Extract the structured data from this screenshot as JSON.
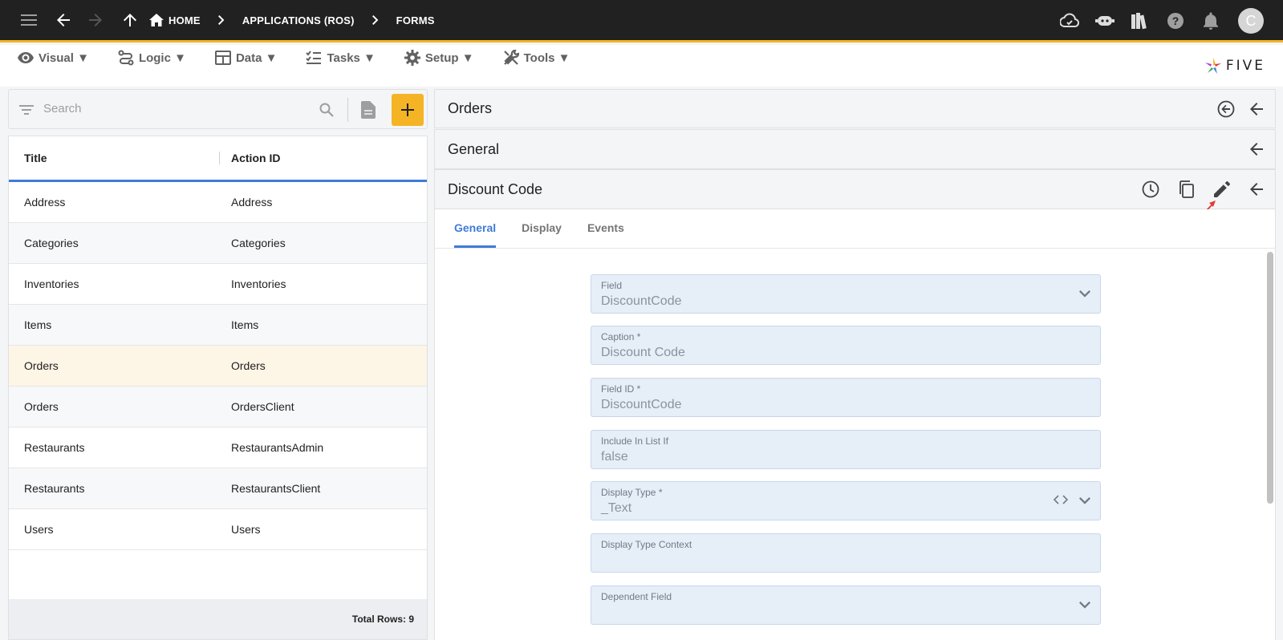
{
  "breadcrumbs": [
    "HOME",
    "APPLICATIONS (ROS)",
    "FORMS"
  ],
  "menu": [
    {
      "label": "Visual ▼",
      "icon": "eye-icon"
    },
    {
      "label": "Logic ▼",
      "icon": "logic-icon"
    },
    {
      "label": "Data ▼",
      "icon": "table-icon"
    },
    {
      "label": "Tasks ▼",
      "icon": "checklist-icon"
    },
    {
      "label": "Setup ▼",
      "icon": "gear-icon"
    },
    {
      "label": "Tools ▼",
      "icon": "tools-icon"
    }
  ],
  "logo_text": "FIVE",
  "user_initial": "C",
  "search": {
    "placeholder": "Search"
  },
  "grid": {
    "columns": [
      "Title",
      "Action ID"
    ],
    "rows": [
      [
        "Address",
        "Address"
      ],
      [
        "Categories",
        "Categories"
      ],
      [
        "Inventories",
        "Inventories"
      ],
      [
        "Items",
        "Items"
      ],
      [
        "Orders",
        "Orders"
      ],
      [
        "Orders",
        "OrdersClient"
      ],
      [
        "Restaurants",
        "RestaurantsAdmin"
      ],
      [
        "Restaurants",
        "RestaurantsClient"
      ],
      [
        "Users",
        "Users"
      ]
    ],
    "selected_row": 4,
    "footer": "Total Rows: 9"
  },
  "panels": {
    "level1_title": "Orders",
    "level2_title": "General",
    "level3_title": "Discount Code"
  },
  "tabs": [
    "General",
    "Display",
    "Events"
  ],
  "active_tab": 0,
  "fields": [
    {
      "label": "Field",
      "value": "DiscountCode"
    },
    {
      "label": "Caption *",
      "value": "Discount Code"
    },
    {
      "label": "Field ID *",
      "value": "DiscountCode"
    },
    {
      "label": "Include In List If",
      "value": "false"
    },
    {
      "label": "Display Type *",
      "value": "_Text"
    },
    {
      "label": "Display Type Context",
      "value": ""
    },
    {
      "label": "Dependent Field",
      "value": ""
    }
  ],
  "colors": {
    "accent": "#f5b425",
    "primary": "#3f7bd6",
    "topbar": "#212121",
    "selected_row": "#fdf5e6"
  }
}
